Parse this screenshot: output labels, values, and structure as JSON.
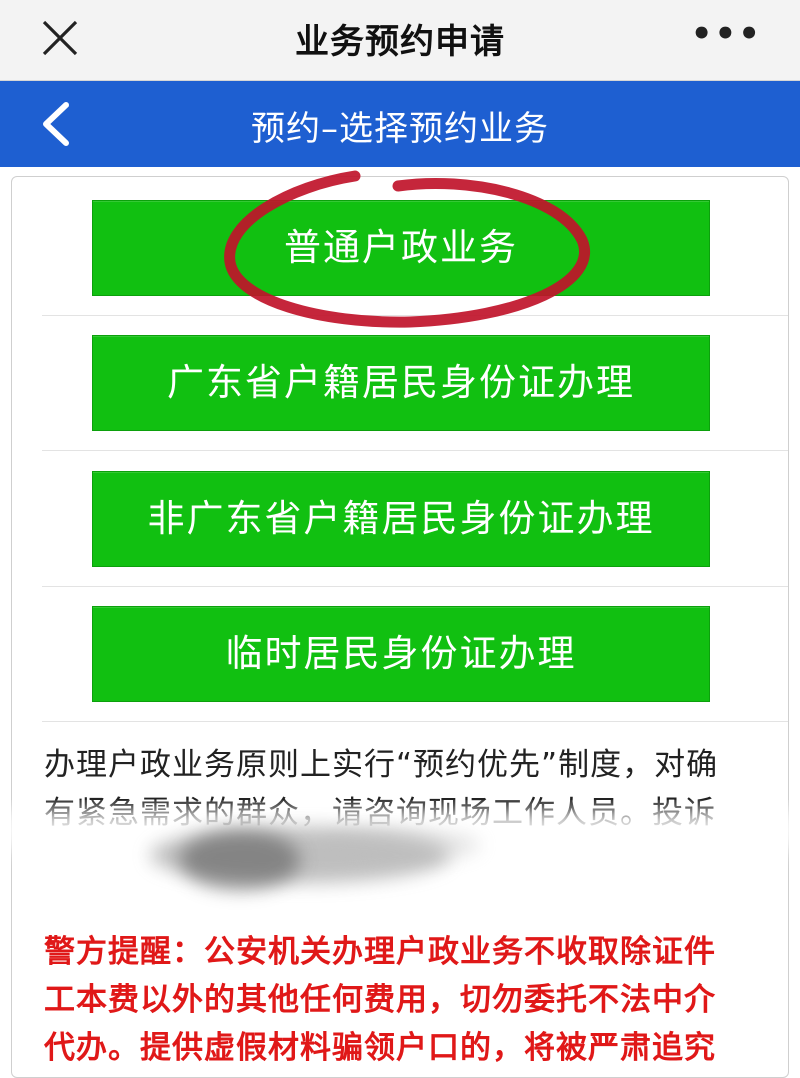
{
  "window": {
    "title": "业务预约申请",
    "more_label": "•••"
  },
  "nav": {
    "title": "预约–选择预约业务"
  },
  "services": [
    {
      "label": "普通户政业务"
    },
    {
      "label": "广东省户籍居民身份证办理"
    },
    {
      "label": "非广东省户籍居民身份证办理"
    },
    {
      "label": "临时居民身份证办理"
    }
  ],
  "notice": {
    "line1": "办理户政业务原则上实行“预约优先”制度，对确",
    "line2": "有紧急需求的群众，请咨询现场工作人员。投诉"
  },
  "warning": {
    "line1": "警方提醒：公安机关办理户政业务不收取除证件",
    "line2": "工本费以外的其他任何费用，切勿委托不法中介",
    "line3": "代办。提供虚假材料骗领户口的，将被严肃追究"
  },
  "colors": {
    "nav_blue": "#1e5fd1",
    "button_green": "#11c011",
    "warning_red": "#e01818",
    "annotation_red": "#c0142a"
  },
  "icons": {
    "close": "close-icon",
    "more": "more-icon",
    "back": "back-arrow-icon"
  }
}
